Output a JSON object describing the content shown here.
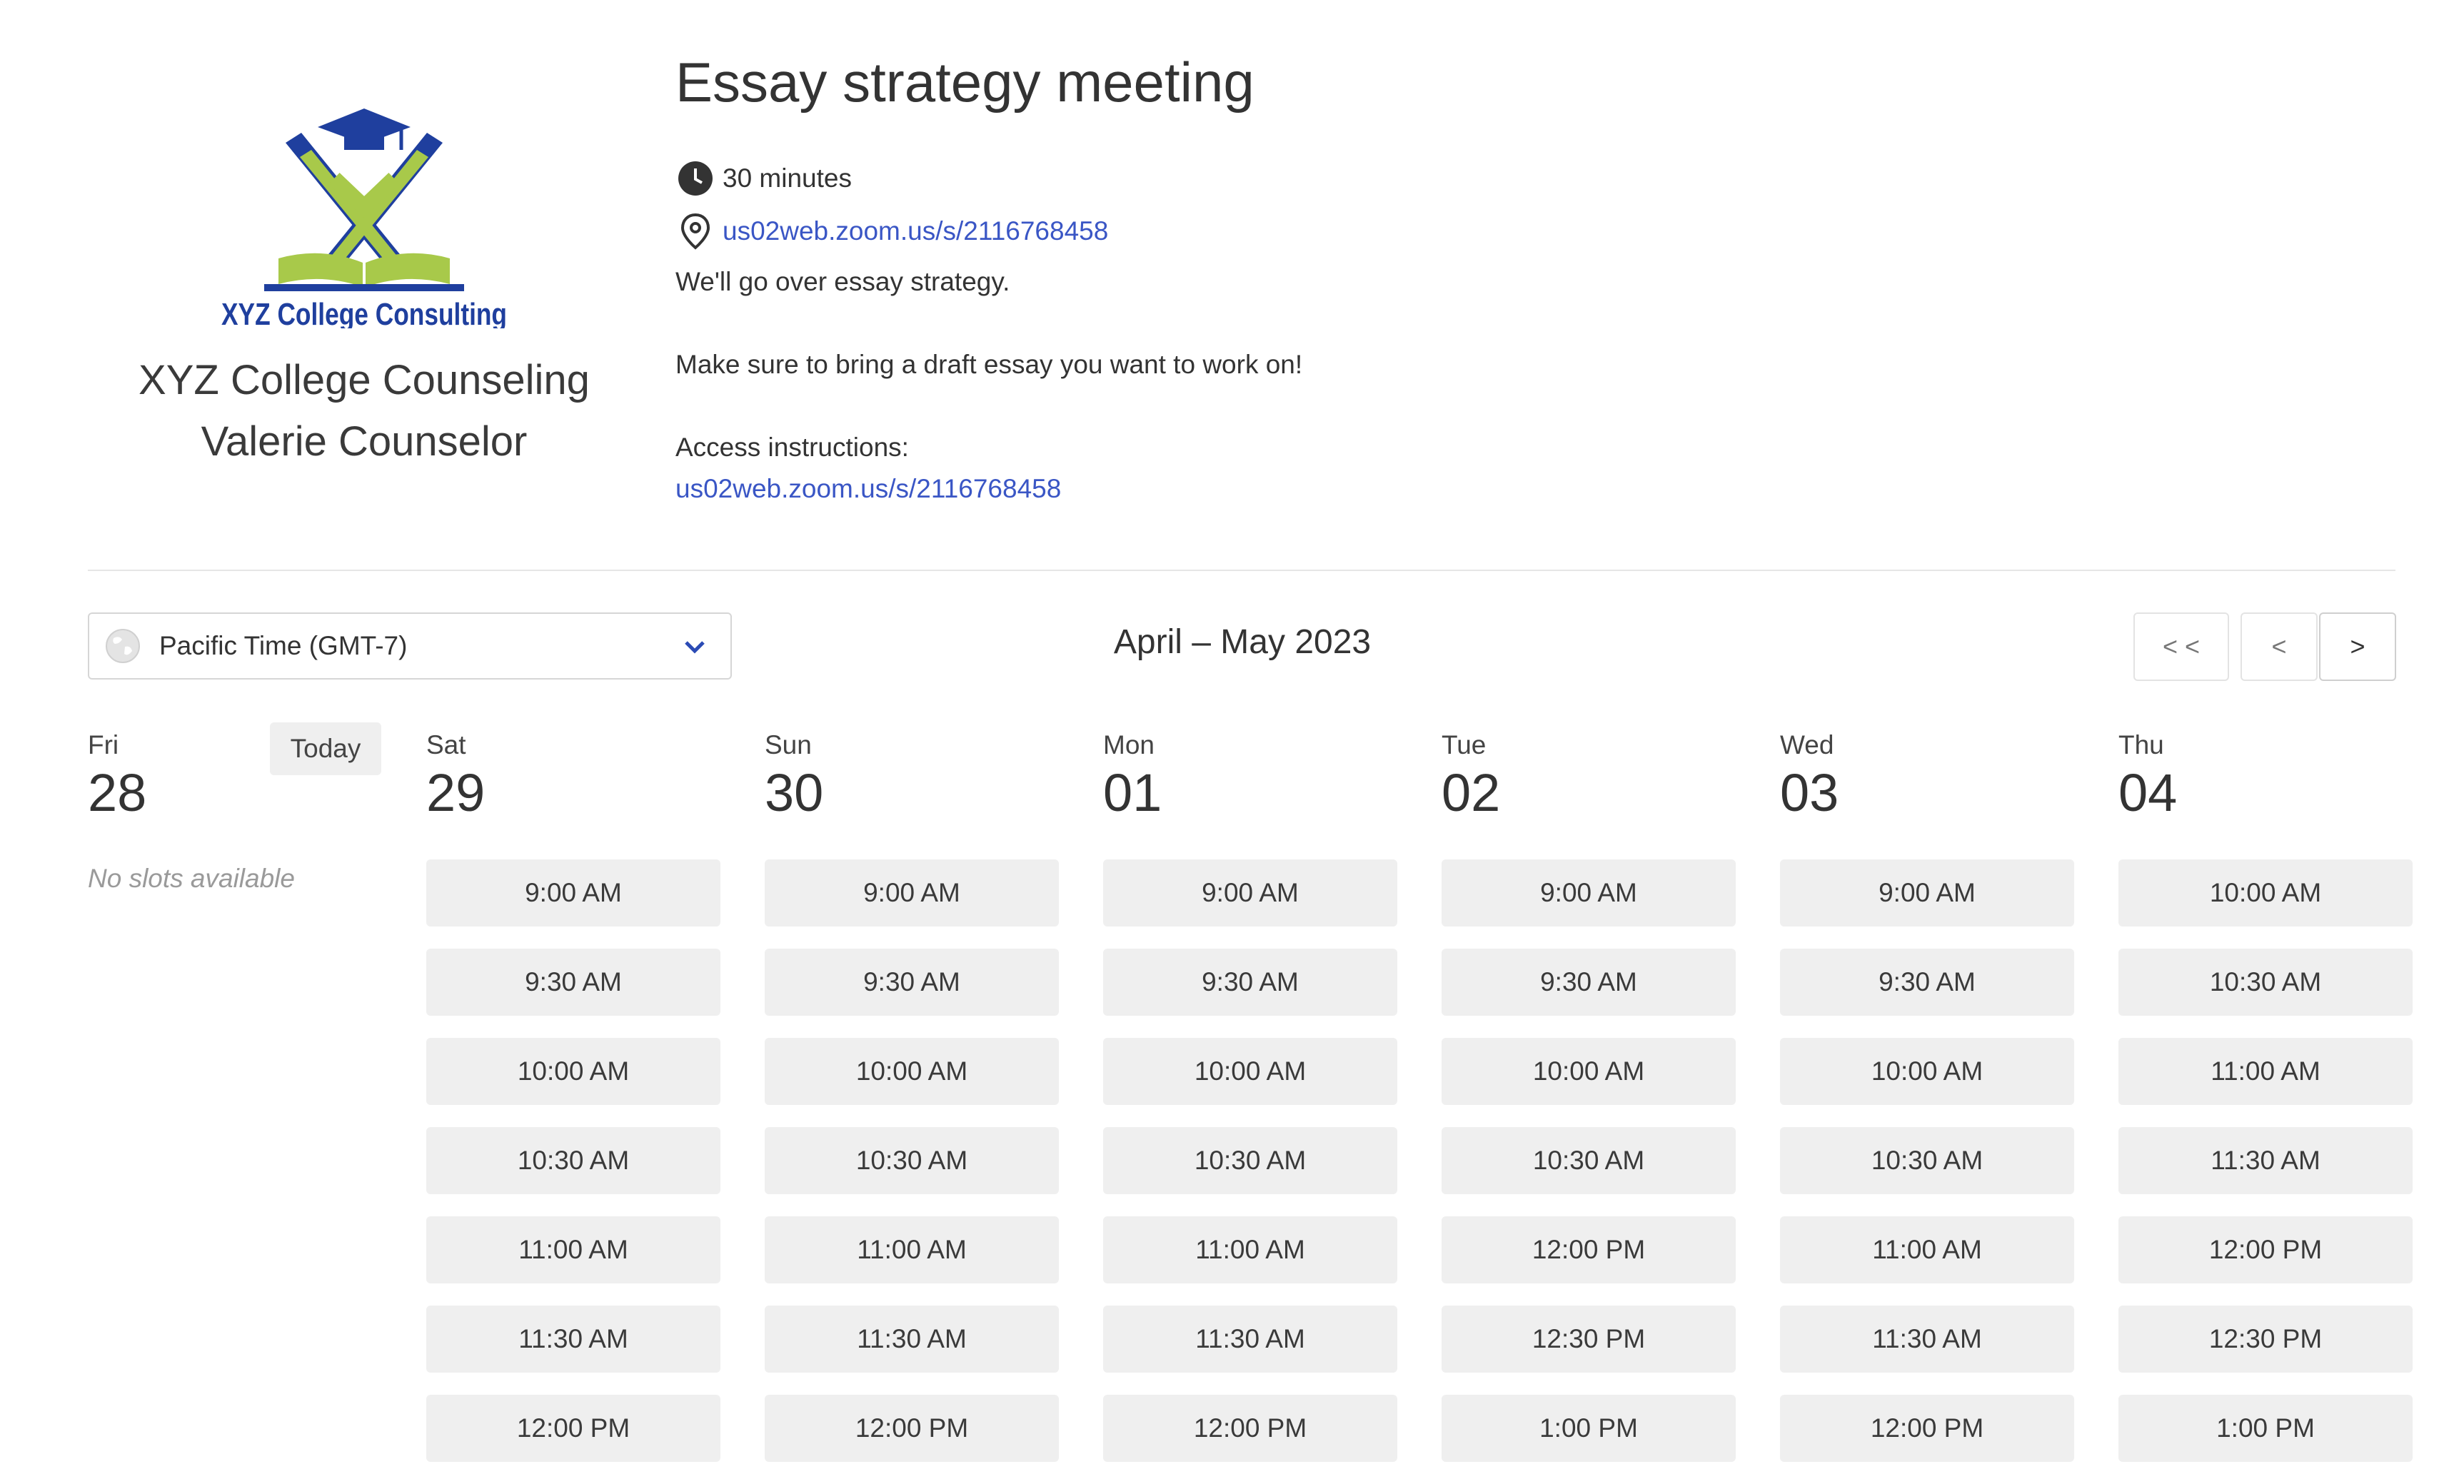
{
  "organization": {
    "logo_text": "XYZ College Consulting",
    "name": "XYZ College Counseling",
    "person": "Valerie Counselor"
  },
  "event": {
    "title": "Essay strategy meeting",
    "duration": "30 minutes",
    "location_link": "us02web.zoom.us/s/2116768458",
    "description_line1": "We'll go over essay strategy.",
    "description_line2": "Make sure to bring a draft essay you want to work on!",
    "access_label": "Access instructions:",
    "access_link": "us02web.zoom.us/s/2116768458"
  },
  "controls": {
    "timezone": "Pacific Time (GMT-7)",
    "month_label": "April – May 2023",
    "first_label": "< <",
    "prev_label": "<",
    "next_label": ">",
    "today_label": "Today",
    "no_slots": "No slots available"
  },
  "colors": {
    "link": "#3a56c5",
    "slot_bg": "#efefef",
    "logo_blue": "#1f3f9e",
    "logo_green": "#a8c94a"
  },
  "days": [
    {
      "dow": "Fri",
      "num": "28",
      "slots": []
    },
    {
      "dow": "Sat",
      "num": "29",
      "slots": [
        "9:00 AM",
        "9:30 AM",
        "10:00 AM",
        "10:30 AM",
        "11:00 AM",
        "11:30 AM",
        "12:00 PM"
      ]
    },
    {
      "dow": "Sun",
      "num": "30",
      "slots": [
        "9:00 AM",
        "9:30 AM",
        "10:00 AM",
        "10:30 AM",
        "11:00 AM",
        "11:30 AM",
        "12:00 PM"
      ]
    },
    {
      "dow": "Mon",
      "num": "01",
      "slots": [
        "9:00 AM",
        "9:30 AM",
        "10:00 AM",
        "10:30 AM",
        "11:00 AM",
        "11:30 AM",
        "12:00 PM"
      ]
    },
    {
      "dow": "Tue",
      "num": "02",
      "slots": [
        "9:00 AM",
        "9:30 AM",
        "10:00 AM",
        "10:30 AM",
        "12:00 PM",
        "12:30 PM",
        "1:00 PM"
      ]
    },
    {
      "dow": "Wed",
      "num": "03",
      "slots": [
        "9:00 AM",
        "9:30 AM",
        "10:00 AM",
        "10:30 AM",
        "11:00 AM",
        "11:30 AM",
        "12:00 PM"
      ]
    },
    {
      "dow": "Thu",
      "num": "04",
      "slots": [
        "10:00 AM",
        "10:30 AM",
        "11:00 AM",
        "11:30 AM",
        "12:00 PM",
        "12:30 PM",
        "1:00 PM"
      ]
    }
  ]
}
